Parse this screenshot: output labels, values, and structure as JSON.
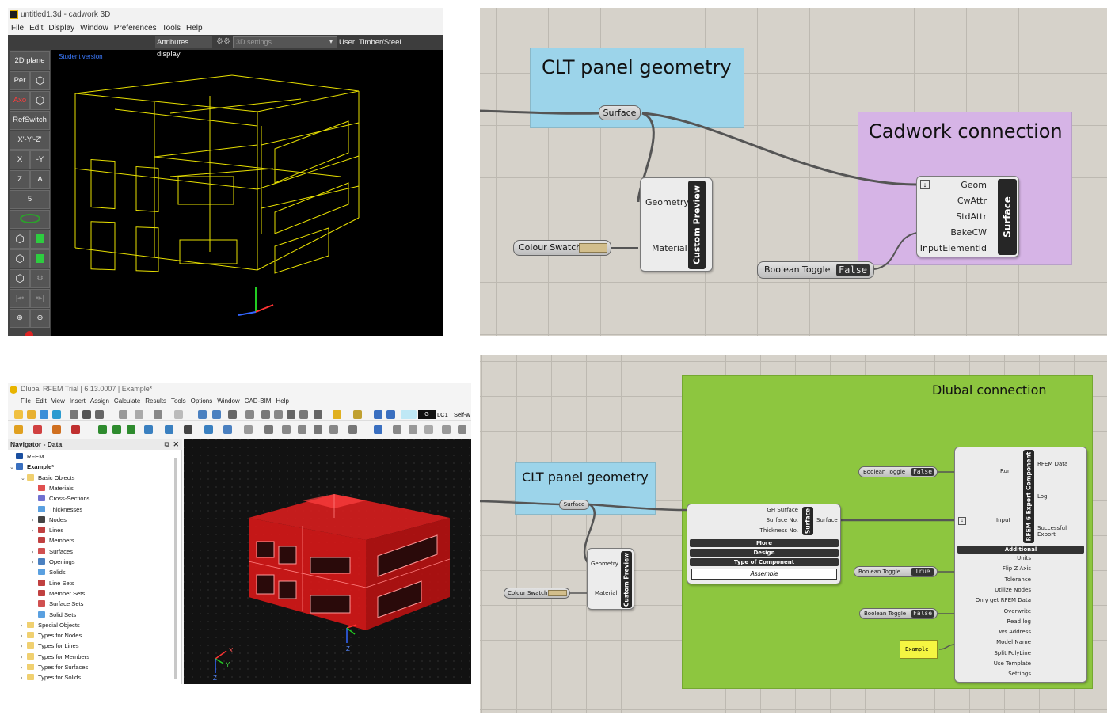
{
  "cadwork": {
    "title": "untitled1.3d - cadwork 3D",
    "menu": [
      "File",
      "Edit",
      "Display",
      "Window",
      "Preferences",
      "Tools",
      "Help"
    ],
    "toolbar": {
      "attributes_display": "Attributes display",
      "settings_placeholder": "3D settings",
      "user_label": "User",
      "user_value": "Timber/Steel"
    },
    "left_buttons": [
      "2D plane",
      "Per",
      "Axo",
      "RefSwitch",
      "X'-Y'-Z'",
      "X",
      "-Y",
      "Z",
      "A",
      "5"
    ],
    "student_label": "Student version",
    "colors": {
      "wireframe": "#e8e000",
      "background": "#000000"
    }
  },
  "gh_cadwork": {
    "group_clt": "CLT panel geometry",
    "group_cadwork": "Cadwork connection",
    "surface_param": "Surface",
    "custom_preview": {
      "inputs": [
        "Geometry",
        "Material"
      ],
      "name": "Custom Preview"
    },
    "colour_swatch": "Colour Swatch",
    "cadwork_component": {
      "inputs": [
        "Geom",
        "CwAttr",
        "StdAttr",
        "BakeCW",
        "InputElementId"
      ],
      "name": "Surface"
    },
    "boolean_toggle": {
      "label": "Boolean Toggle",
      "value": "False"
    },
    "colors": {
      "clt_group": "#9cd4ea",
      "cadwork_group": "#d6b4e6",
      "swatch": "#d2be8c"
    }
  },
  "rfem": {
    "title": "Dlubal RFEM Trial | 6.13.0007 | Example*",
    "menu": [
      "File",
      "Edit",
      "View",
      "Insert",
      "Assign",
      "Calculate",
      "Results",
      "Tools",
      "Options",
      "Window",
      "CAD-BIM",
      "Help"
    ],
    "toolbar_text": [
      "G",
      "LC1",
      "Self-w"
    ],
    "navigator_title": "Navigator - Data",
    "tree": [
      {
        "label": "RFEM",
        "level": 0,
        "twisty": "",
        "icon": "rfem"
      },
      {
        "label": "Example*",
        "level": 0,
        "twisty": "⌄",
        "icon": "doc",
        "bold": true
      },
      {
        "label": "Basic Objects",
        "level": 1,
        "twisty": "⌄",
        "icon": "folder"
      },
      {
        "label": "Materials",
        "level": 2,
        "twisty": "",
        "icon": "mat"
      },
      {
        "label": "Cross-Sections",
        "level": 2,
        "twisty": "",
        "icon": "cs"
      },
      {
        "label": "Thicknesses",
        "level": 2,
        "twisty": "",
        "icon": "thk"
      },
      {
        "label": "Nodes",
        "level": 2,
        "twisty": "›",
        "icon": "node"
      },
      {
        "label": "Lines",
        "level": 2,
        "twisty": "›",
        "icon": "line"
      },
      {
        "label": "Members",
        "level": 2,
        "twisty": "",
        "icon": "line"
      },
      {
        "label": "Surfaces",
        "level": 2,
        "twisty": "›",
        "icon": "surf"
      },
      {
        "label": "Openings",
        "level": 2,
        "twisty": "›",
        "icon": "open"
      },
      {
        "label": "Solids",
        "level": 2,
        "twisty": "",
        "icon": "solid"
      },
      {
        "label": "Line Sets",
        "level": 2,
        "twisty": "",
        "icon": "line"
      },
      {
        "label": "Member Sets",
        "level": 2,
        "twisty": "",
        "icon": "line"
      },
      {
        "label": "Surface Sets",
        "level": 2,
        "twisty": "",
        "icon": "surf"
      },
      {
        "label": "Solid Sets",
        "level": 2,
        "twisty": "",
        "icon": "solid"
      },
      {
        "label": "Special Objects",
        "level": 1,
        "twisty": "›",
        "icon": "folder"
      },
      {
        "label": "Types for Nodes",
        "level": 1,
        "twisty": "›",
        "icon": "folder"
      },
      {
        "label": "Types for Lines",
        "level": 1,
        "twisty": "›",
        "icon": "folder"
      },
      {
        "label": "Types for Members",
        "level": 1,
        "twisty": "›",
        "icon": "folder"
      },
      {
        "label": "Types for Surfaces",
        "level": 1,
        "twisty": "›",
        "icon": "folder"
      },
      {
        "label": "Types for Solids",
        "level": 1,
        "twisty": "›",
        "icon": "folder"
      }
    ],
    "axis_labels": {
      "x": "X",
      "y": "Y",
      "z": "Z"
    },
    "colors": {
      "model": "#e41e1e"
    }
  },
  "gh_dlubal": {
    "group_title": "Dlubal connection",
    "group_clt": "CLT panel geometry",
    "surface_param": "Surface",
    "custom_preview": {
      "inputs": [
        "Geometry",
        "Material"
      ],
      "name": "Custom Preview"
    },
    "colour_swatch": "Colour Swatch",
    "surface_component": {
      "inputs": [
        "GH Surface",
        "Surface No.",
        "Thickness No."
      ],
      "name": "Surface",
      "output": "Surface",
      "sections": [
        "More",
        "Design",
        "Type of Component"
      ],
      "dropdown_value": "Assemble"
    },
    "export_component": {
      "name": "RFEM 6 Export Component",
      "inputs_top": [
        "Run",
        "Input"
      ],
      "outputs": [
        "RFEM Data",
        "Log",
        "Successful Export"
      ],
      "additional_label": "Additional",
      "additional_inputs": [
        "Units",
        "Flip Z Axis",
        "Tolerance",
        "Utilize Nodes",
        "Only get RFEM Data",
        "Overwrite",
        "Read log",
        "Ws Address",
        "Model Name",
        "Split PolyLine",
        "Use Template",
        "Settings"
      ]
    },
    "toggles": [
      {
        "label": "Boolean Toggle",
        "value": "False"
      },
      {
        "label": "Boolean Toggle",
        "value": "True"
      },
      {
        "label": "Boolean Toggle",
        "value": "False"
      }
    ],
    "panel_text": "Example",
    "colors": {
      "dlubal_group": "#8dc63f",
      "clt_group": "#9cd4ea",
      "panel": "#f5f542"
    }
  }
}
